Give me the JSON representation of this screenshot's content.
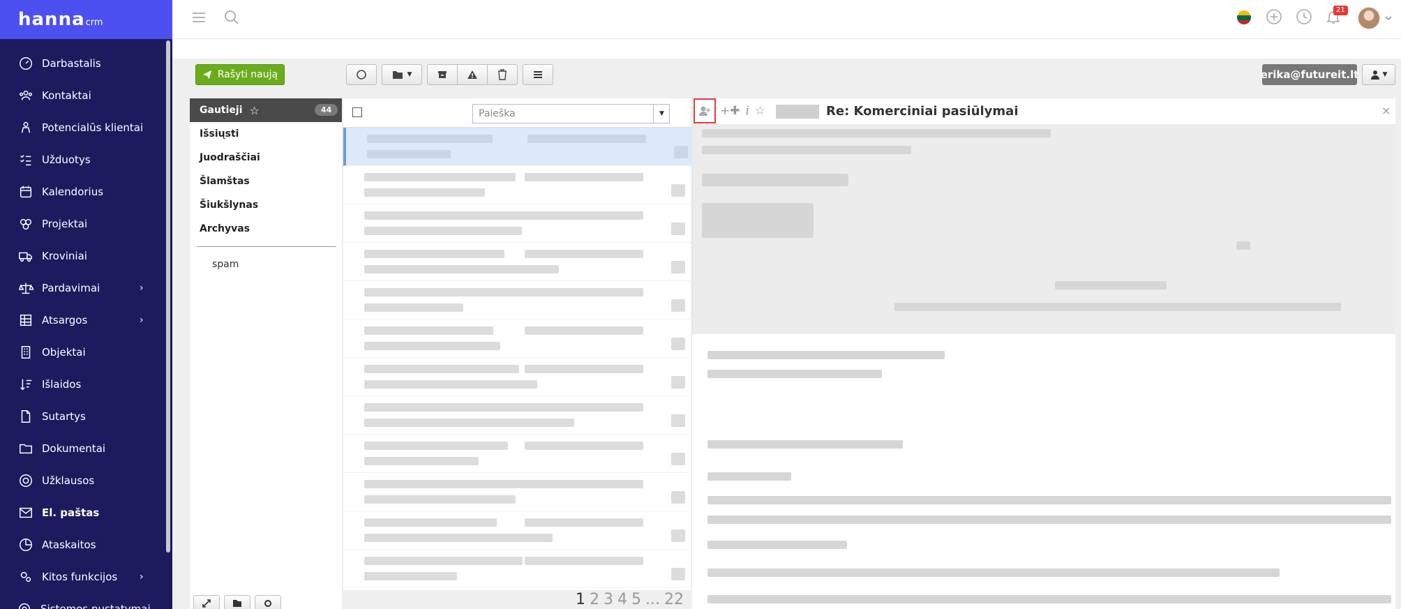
{
  "brand": {
    "name": "hanna",
    "suffix": "crm"
  },
  "nav": {
    "items": [
      {
        "label": "Darbastalis",
        "icon": "dashboard-icon"
      },
      {
        "label": "Kontaktai",
        "icon": "contacts-icon"
      },
      {
        "label": "Potencialūs klientai",
        "icon": "leads-icon"
      },
      {
        "label": "Užduotys",
        "icon": "tasks-icon"
      },
      {
        "label": "Kalendorius",
        "icon": "calendar-icon"
      },
      {
        "label": "Projektai",
        "icon": "projects-icon"
      },
      {
        "label": "Kroviniai",
        "icon": "truck-icon"
      },
      {
        "label": "Pardavimai",
        "icon": "scales-icon"
      },
      {
        "label": "Atsargos",
        "icon": "grid-icon"
      },
      {
        "label": "Objektai",
        "icon": "building-icon"
      },
      {
        "label": "Išlaidos",
        "icon": "sort-icon"
      },
      {
        "label": "Sutartys",
        "icon": "document-icon"
      },
      {
        "label": "Dokumentai",
        "icon": "folder-icon"
      },
      {
        "label": "Užklausos",
        "icon": "lifebuoy-icon"
      },
      {
        "label": "El. paštas",
        "icon": "mail-icon"
      },
      {
        "label": "Ataskaitos",
        "icon": "pie-chart-icon"
      },
      {
        "label": "Kitos funkcijos",
        "icon": "gears-icon"
      },
      {
        "label": "Sistemos nustatymai",
        "icon": "settings-icon"
      }
    ]
  },
  "topbar": {
    "notification_count": "21"
  },
  "toolbar": {
    "compose_label": "Rašyti naują",
    "account": "erika@futureit.lt"
  },
  "folders": {
    "active": {
      "label": "Gautieji",
      "count": "44"
    },
    "items": [
      "Išsiųsti",
      "Juodraščiai",
      "Šlamštas",
      "Šiukšlynas",
      "Archyvas"
    ],
    "sub": [
      "spam"
    ]
  },
  "list": {
    "search_placeholder": "Paieška",
    "pages": [
      "1",
      "2",
      "3",
      "4",
      "5",
      "...",
      "22"
    ]
  },
  "reader": {
    "subject": "Re: Komerciniai pasiūlymai",
    "close": "×"
  },
  "colors": {
    "nav_bg": "#1e1a5e",
    "logo_bg": "#4c50f0",
    "compose_green": "#6bac1c",
    "badge_red": "#e53935",
    "selected_row": "#dde9f8"
  }
}
